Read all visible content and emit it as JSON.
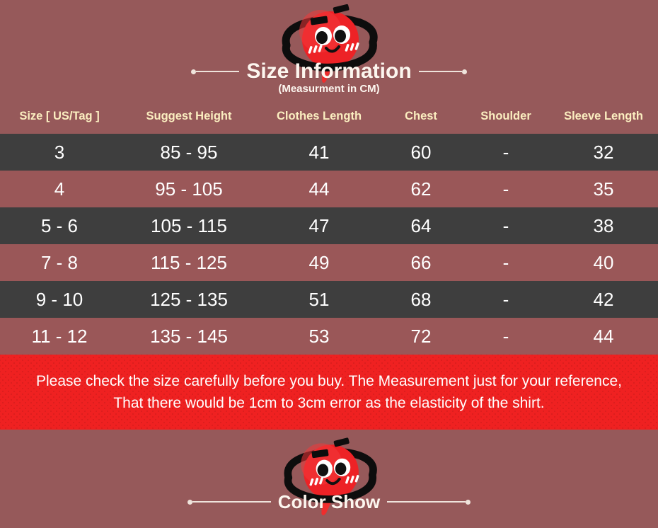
{
  "page": {
    "background_color": "#96595A",
    "row_dark_color": "#3E3E3E",
    "row_rose_color": "#9A5758",
    "notice_color": "#EF2121",
    "header_text_color": "#FBEEC0",
    "mascot_color": "#ED2226"
  },
  "top": {
    "title": "Size Information",
    "subtitle": "(Measurment in CM)",
    "mascot_icon": "red-planet-mascot-icon",
    "deco_left_icon": "dot-dash-left-icon",
    "deco_right_icon": "dot-dash-right-icon"
  },
  "table": {
    "headers": [
      "Size [ US/Tag ]",
      "Suggest Height",
      "Clothes Length",
      "Chest",
      "Shoulder",
      "Sleeve Length"
    ],
    "rows": [
      {
        "size": "3",
        "height": "85 - 95",
        "clothes_length": "41",
        "chest": "60",
        "shoulder": "-",
        "sleeve_length": "32"
      },
      {
        "size": "4",
        "height": "95 - 105",
        "clothes_length": "44",
        "chest": "62",
        "shoulder": "-",
        "sleeve_length": "35"
      },
      {
        "size": "5 - 6",
        "height": "105 - 115",
        "clothes_length": "47",
        "chest": "64",
        "shoulder": "-",
        "sleeve_length": "38"
      },
      {
        "size": "7 - 8",
        "height": "115 - 125",
        "clothes_length": "49",
        "chest": "66",
        "shoulder": "-",
        "sleeve_length": "40"
      },
      {
        "size": "9 - 10",
        "height": "125 - 135",
        "clothes_length": "51",
        "chest": "68",
        "shoulder": "-",
        "sleeve_length": "42"
      },
      {
        "size": "11 - 12",
        "height": "135 - 145",
        "clothes_length": "53",
        "chest": "72",
        "shoulder": "-",
        "sleeve_length": "44"
      }
    ]
  },
  "notice": {
    "line1": "Please check the size carefully before you buy. The Measurement just for your reference,",
    "line2": "That there would be 1cm to 3cm error as the elasticity of the shirt."
  },
  "bottom": {
    "title": "Color Show",
    "mascot_icon": "red-planet-mascot-icon",
    "deco_left_icon": "dot-dash-left-icon",
    "deco_right_icon": "dot-dash-right-icon"
  }
}
